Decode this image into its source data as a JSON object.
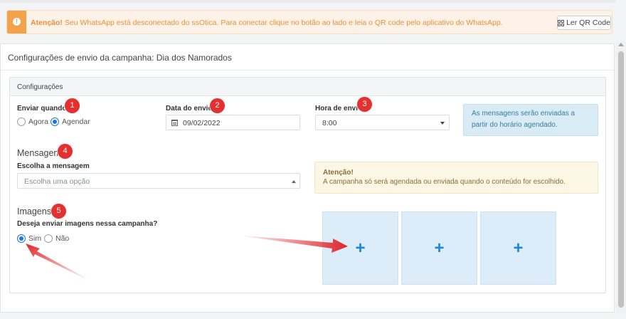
{
  "alert": {
    "icon": "exclamation-icon",
    "strong": "Atenção!",
    "message": " Seu WhatsApp está desconectado do ssOtica. Para conectar clique no botão ao lado e leia o QR code pelo aplicativo do WhatsApp.",
    "button_label": "Ler QR Code",
    "button_icon": "qrcode-icon"
  },
  "page": {
    "title": "Configurações de envio da campanha: Dia dos Namorados"
  },
  "config": {
    "header": "Configurações",
    "enviar_quando": {
      "label": "Enviar quando?",
      "options": [
        "Agora",
        "Agendar"
      ],
      "selected": "Agendar"
    },
    "data_envio": {
      "label": "Data do envio",
      "value": "09/02/2022",
      "icon": "calendar-icon"
    },
    "hora_envio": {
      "label": "Hora de envio",
      "value": "8:00"
    },
    "info": "As mensagens serão enviadas a partir do horário agendado.",
    "mensagem": {
      "title": "Mensagem",
      "label": "Escolha a mensagem",
      "placeholder": "Escolha uma opção"
    },
    "warning": {
      "title": "Atenção!",
      "text": "A campanha só será agendada ou enviada quando o conteúdo for escolhido."
    },
    "imagens": {
      "title": "Imagens",
      "question": "Deseja enviar imagens nessa campanha?",
      "options": [
        "Sim",
        "Não"
      ],
      "selected": "Sim",
      "slots": [
        "+",
        "+",
        "+"
      ]
    }
  },
  "badges": [
    "1",
    "2",
    "3",
    "4",
    "5"
  ],
  "colors": {
    "alert_orange": "#f2a24a",
    "accent_blue": "#1a73e8",
    "badge_red": "#e53030",
    "plus_blue": "#1d87d8"
  }
}
